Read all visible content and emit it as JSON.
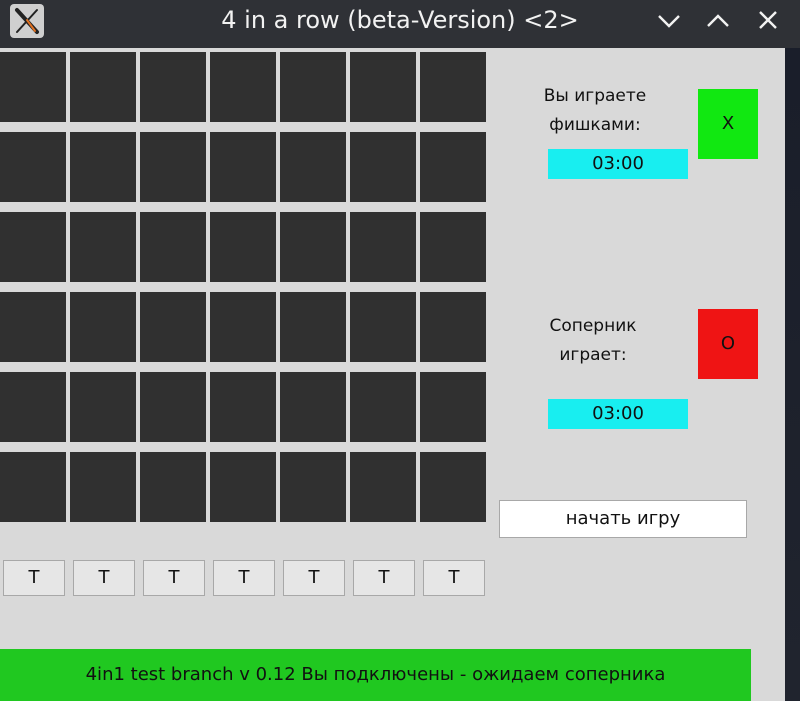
{
  "window": {
    "title": "4 in a row (beta-Version) <2>",
    "icon": "x-logo-icon",
    "controls": [
      "minimize-icon",
      "maximize-icon",
      "close-icon"
    ]
  },
  "board": {
    "columns": 7,
    "rows": 6,
    "cell_color": "#303030",
    "column_buttons": [
      "T",
      "T",
      "T",
      "T",
      "T",
      "T",
      "T"
    ]
  },
  "player": {
    "label_line1": "Вы играете",
    "label_line2": "фишками:",
    "piece": "X",
    "piece_color": "#11e811",
    "timer": "03:00"
  },
  "opponent": {
    "label_line1": "Соперник",
    "label_line2": "играет:",
    "piece": "O",
    "piece_color": "#ef1414",
    "timer": "03:00"
  },
  "timer_color": "#18eef0",
  "start_button": {
    "label": "начать игру"
  },
  "status": {
    "text": "4in1 test branch v 0.12 Вы подключены - ожидаем соперника",
    "color": "#20c820"
  }
}
